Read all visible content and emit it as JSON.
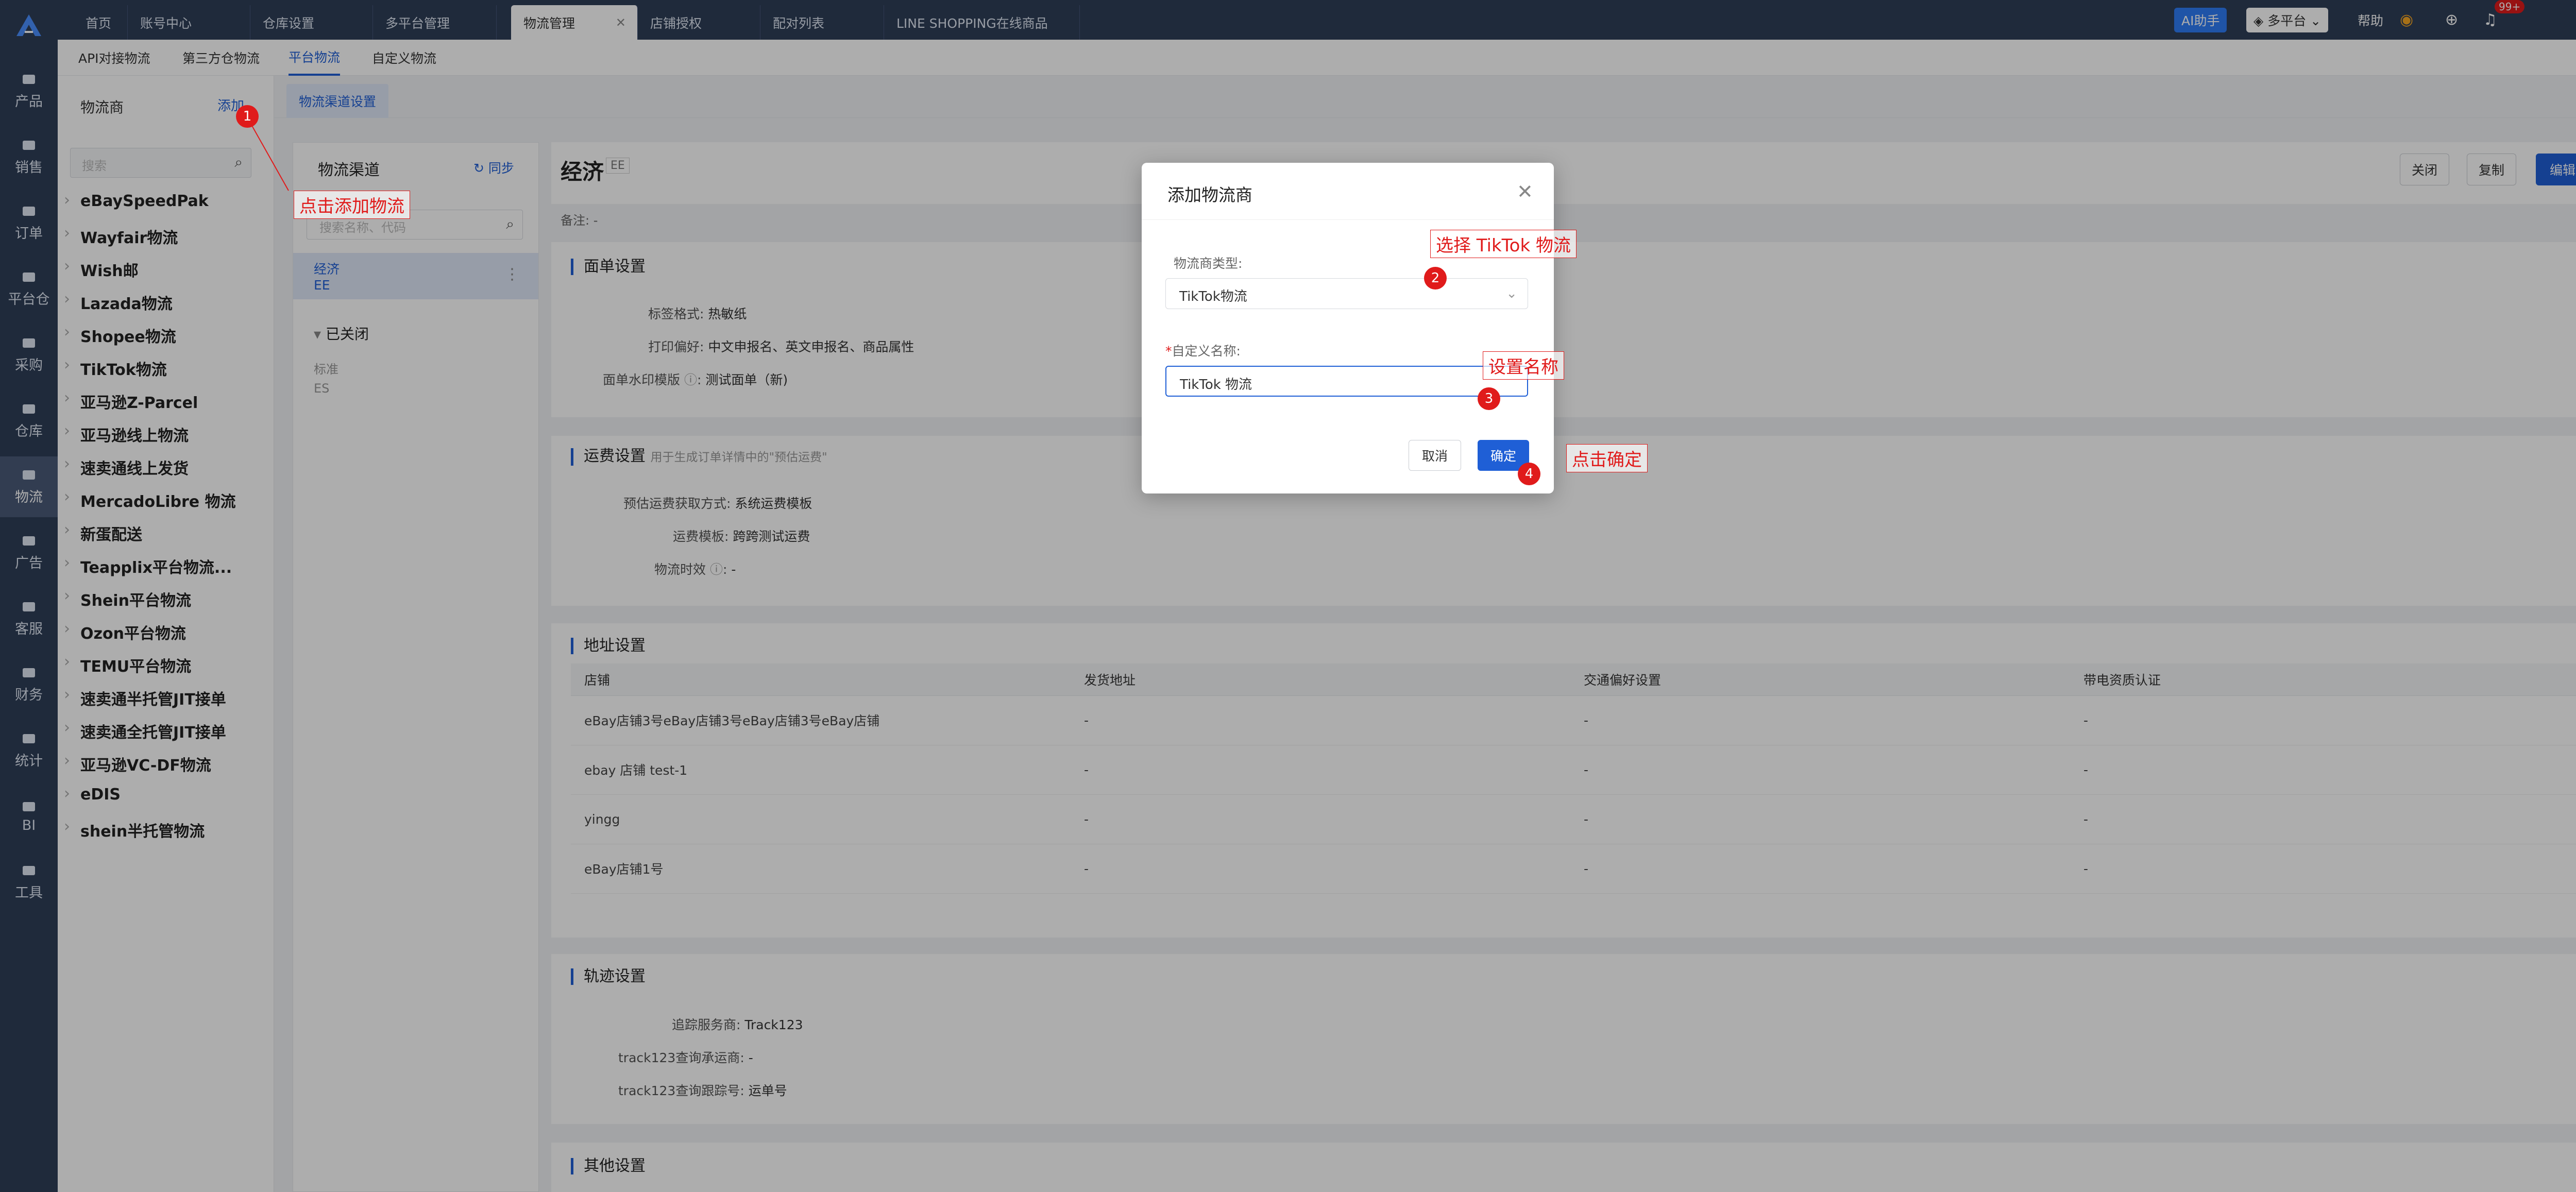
{
  "rail": {
    "items": [
      {
        "label": "产品",
        "icon": "box-icon"
      },
      {
        "label": "销售",
        "icon": "shop-icon"
      },
      {
        "label": "订单",
        "icon": "order-icon"
      },
      {
        "label": "平台仓",
        "icon": "warehouse-icon"
      },
      {
        "label": "采购",
        "icon": "cart-icon"
      },
      {
        "label": "仓库",
        "icon": "warehouse-icon"
      },
      {
        "label": "物流",
        "icon": "truck-icon"
      },
      {
        "label": "广告",
        "icon": "ad-icon"
      },
      {
        "label": "客服",
        "icon": "mail-icon"
      },
      {
        "label": "财务",
        "icon": "money-icon"
      },
      {
        "label": "统计",
        "icon": "chart-icon"
      },
      {
        "label": "BI",
        "icon": "bi-icon"
      },
      {
        "label": "工具",
        "icon": "tool-icon"
      }
    ]
  },
  "tabs": [
    "首页",
    "账号中心",
    "仓库设置",
    "多平台管理",
    "物流管理",
    "店铺授权",
    "配对列表",
    "LINE SHOPPING在线商品"
  ],
  "topbar": {
    "ai": "AI助手",
    "platform": "多平台",
    "help": "帮助",
    "notif_count": "99+"
  },
  "subnav": [
    "API对接物流",
    "第三方仓物流",
    "平台物流",
    "自定义物流"
  ],
  "left": {
    "title": "物流商",
    "add": "添加",
    "search_placeholder": "搜索",
    "providers": [
      "eBaySpeedPak",
      "Wayfair物流",
      "Wish邮",
      "Lazada物流",
      "Shopee物流",
      "TikTok物流",
      "亚马逊Z-Parcel",
      "亚马逊线上物流",
      "速卖通线上发货",
      "MercadoLibre 物流",
      "新蛋配送",
      "Teapplix平台物流...",
      "Shein平台物流",
      "Ozon平台物流",
      "TEMU平台物流",
      "速卖通半托管JIT接单",
      "速卖通全托管JIT接单",
      "亚马逊VC-DF物流",
      "eDIS",
      "shein半托管物流"
    ]
  },
  "content_tab": "物流渠道设置",
  "channels": {
    "title": "物流渠道",
    "sync": "同步",
    "search_placeholder": "搜索名称、代码",
    "selected_name": "经济",
    "selected_code": "EE",
    "closed_title": "已关闭",
    "closed_name": "标准",
    "closed_code": "ES"
  },
  "detail": {
    "name": "经济",
    "code": "EE",
    "remark": "备注: -",
    "btn_close": "关闭",
    "btn_copy": "复制",
    "btn_edit": "编辑",
    "face": {
      "title": "面单设置",
      "label_format_k": "标签格式:",
      "label_format_v": "热敏纸",
      "print_pref_k": "打印偏好:",
      "print_pref_v": "中文申报名、英文申报名、商品属性",
      "watermark_k": "面单水印模版",
      "watermark_v": "测试面单（新)"
    },
    "freight": {
      "title": "运费设置",
      "hint": "用于生成订单详情中的\"预估运费\"",
      "method_k": "预估运费获取方式:",
      "method_v": "系统运费模板",
      "template_k": "运费模板:",
      "template_v": "跨跨测试运费",
      "timeliness_k": "物流时效",
      "timeliness_v": "-"
    },
    "address": {
      "title": "地址设置",
      "headers": [
        "店铺",
        "发货地址",
        "交通偏好设置",
        "带电资质认证"
      ],
      "rows": [
        [
          "eBay店铺3号eBay店铺3号eBay店铺3号eBay店铺",
          "-",
          "-",
          "-"
        ],
        [
          "ebay 店铺 test-1",
          "-",
          "-",
          "-"
        ],
        [
          "yingg",
          "-",
          "-",
          "-"
        ],
        [
          "eBay店铺1号",
          "-",
          "-",
          "-"
        ]
      ]
    },
    "track": {
      "title": "轨迹设置",
      "provider_k": "追踪服务商:",
      "provider_v": "Track123",
      "carrier_k": "track123查询承运商:",
      "carrier_v": "-",
      "number_k": "track123查询跟踪号:",
      "number_v": "运单号"
    },
    "other_title": "其他设置"
  },
  "modal": {
    "title": "添加物流商",
    "type_label": "物流商类型:",
    "type_value": "TikTok物流",
    "name_label": "自定义名称:",
    "name_value": "TikTok 物流",
    "cancel": "取消",
    "confirm": "确定"
  },
  "annotations": {
    "a1": "点击添加物流",
    "a2": "选择 TikTok 物流",
    "a3": "设置名称",
    "a4": "点击确定",
    "n1": "1",
    "n2": "2",
    "n3": "3",
    "n4": "4"
  },
  "colors": {
    "primary": "#1f5fd6",
    "rail": "#2f3e58",
    "annotation": "#e01b1b"
  }
}
